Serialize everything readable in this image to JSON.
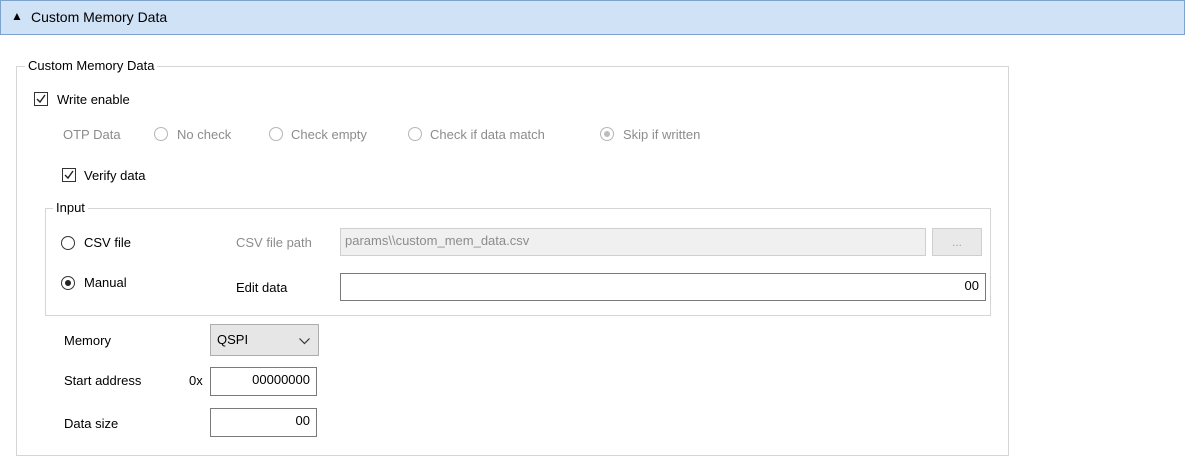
{
  "header": {
    "collapse_icon": "▲",
    "title": "Custom Memory Data"
  },
  "group": {
    "legend": "Custom Memory Data",
    "write_enable": {
      "label": "Write enable",
      "checked": true
    },
    "otp": {
      "label": "OTP Data",
      "options": [
        "No check",
        "Check empty",
        "Check if data match",
        "Skip if written"
      ],
      "selected": "Skip if written"
    },
    "verify_data": {
      "label": "Verify data",
      "checked": true
    },
    "input": {
      "legend": "Input",
      "csv_file_label": "CSV file",
      "manual_label": "Manual",
      "selected": "Manual",
      "csv_path_label": "CSV file path",
      "csv_path_value": "params\\\\custom_mem_data.csv",
      "browse_label": "...",
      "edit_data_label": "Edit data",
      "edit_data_value": "00"
    }
  },
  "memory": {
    "label": "Memory",
    "value": "QSPI"
  },
  "start_address": {
    "label": "Start address",
    "prefix": "0x",
    "value": "00000000"
  },
  "data_size": {
    "label": "Data size",
    "value": "00"
  }
}
